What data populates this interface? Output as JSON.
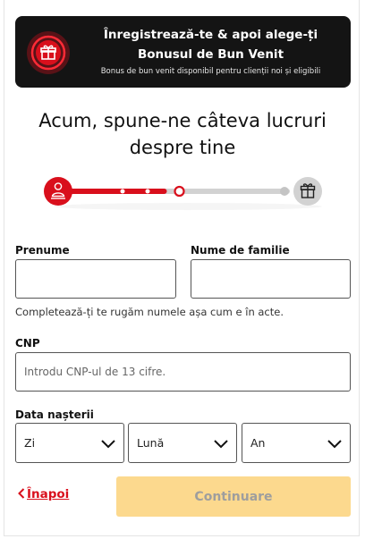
{
  "banner": {
    "badge_icon": "gift-icon",
    "title_line1": "Înregistrează-te & apoi alege-ți",
    "title_line2": "Bonusul de Bun Venit",
    "subtitle": "Bonus de bun venit disponibil pentru clienții noi și eligibili"
  },
  "heading": {
    "line1": "Acum, spune-ne câteva lucruri",
    "line2": "despre tine"
  },
  "progress": {
    "start_icon": "user-icon",
    "end_icon": "gift-icon",
    "completed_fraction": 0.45
  },
  "form": {
    "first_name": {
      "label": "Prenume",
      "value": ""
    },
    "last_name": {
      "label": "Nume de familie",
      "value": ""
    },
    "name_hint": "Completează-ți te rugăm numele așa cum e în acte.",
    "cnp": {
      "label": "CNP",
      "placeholder": "Introdu CNP-ul de 13 cifre."
    },
    "birth_date": {
      "label": "Data nașterii",
      "day": "Zi",
      "month": "Lună",
      "year": "An"
    }
  },
  "actions": {
    "back_label": "Înapoi",
    "continue_label": "Continuare"
  },
  "colors": {
    "accent": "#d90f1c",
    "banner_bg": "#141414",
    "button_disabled_bg": "#fcd98e",
    "track_inactive": "#d2d2d2"
  }
}
